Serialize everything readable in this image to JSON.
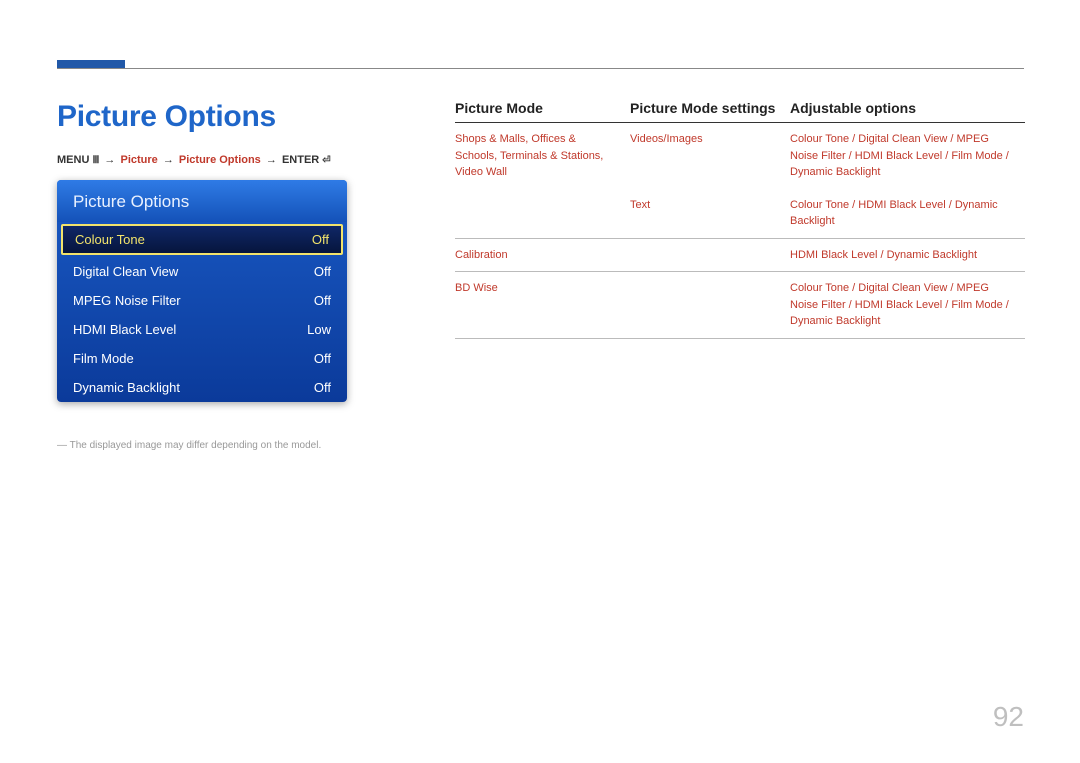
{
  "page": {
    "heading": "Picture Options",
    "number": "92",
    "footnote": "― The displayed image may differ depending on the model."
  },
  "breadcrumb": {
    "menu": "MENU",
    "menu_icon": "Ⅲ",
    "arrow": "→",
    "picture": "Picture",
    "picture_options": "Picture Options",
    "enter": "ENTER",
    "enter_icon": "⏎"
  },
  "osd": {
    "title": "Picture Options",
    "items": [
      {
        "label": "Colour Tone",
        "value": "Off",
        "selected": true
      },
      {
        "label": "Digital Clean View",
        "value": "Off",
        "selected": false
      },
      {
        "label": "MPEG Noise Filter",
        "value": "Off",
        "selected": false
      },
      {
        "label": "HDMI Black Level",
        "value": "Low",
        "selected": false
      },
      {
        "label": "Film Mode",
        "value": "Off",
        "selected": false
      },
      {
        "label": "Dynamic Backlight",
        "value": "Off",
        "selected": false
      }
    ]
  },
  "table": {
    "headers": {
      "mode": "Picture Mode",
      "settings": "Picture Mode settings",
      "adj": "Adjustable options"
    },
    "rows": [
      {
        "mode": "Shops & Malls, Offices & Schools, Terminals & Stations, Video Wall",
        "sub": [
          {
            "settings": "Videos/Images",
            "adj": "Colour Tone / Digital Clean View / MPEG Noise Filter / HDMI Black Level / Film Mode / Dynamic Backlight"
          },
          {
            "settings": "Text",
            "adj": "Colour Tone / HDMI Black Level / Dynamic Backlight"
          }
        ]
      },
      {
        "mode": "Calibration",
        "sub": [
          {
            "settings": "",
            "adj": "HDMI Black Level / Dynamic Backlight"
          }
        ]
      },
      {
        "mode": "BD Wise",
        "sub": [
          {
            "settings": "",
            "adj": "Colour Tone / Digital Clean View / MPEG Noise Filter / HDMI Black Level / Film Mode / Dynamic Backlight"
          }
        ]
      }
    ]
  }
}
